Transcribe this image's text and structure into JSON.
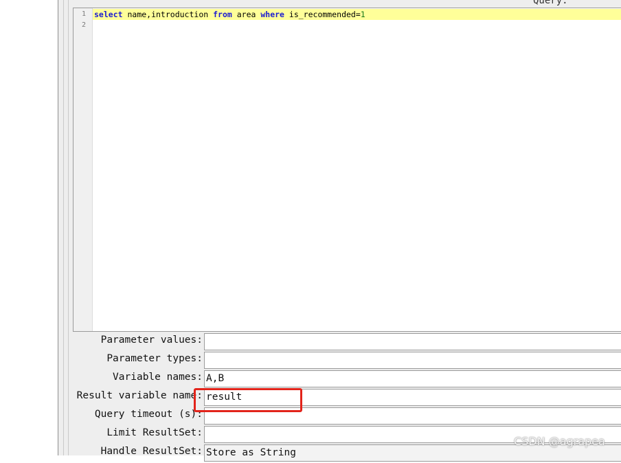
{
  "query_label": "Query:",
  "editor": {
    "line_numbers": [
      "1",
      "2"
    ],
    "lines": [
      [
        {
          "t": "select",
          "cls": "kw"
        },
        {
          "t": " name,introduction ",
          "cls": ""
        },
        {
          "t": "from",
          "cls": "kw"
        },
        {
          "t": " area ",
          "cls": ""
        },
        {
          "t": "where",
          "cls": "kw"
        },
        {
          "t": " is_recommended=",
          "cls": ""
        },
        {
          "t": "1",
          "cls": "num"
        }
      ],
      []
    ]
  },
  "form": {
    "parameter_values": {
      "label": "Parameter values:",
      "value": ""
    },
    "parameter_types": {
      "label": "Parameter types:",
      "value": ""
    },
    "variable_names": {
      "label": "Variable names:",
      "value": "A,B"
    },
    "result_variable_name": {
      "label": "Result variable name:",
      "value": "result"
    },
    "query_timeout": {
      "label": "Query timeout (s):",
      "value": ""
    },
    "limit_resultset": {
      "label": "Limit ResultSet:",
      "value": ""
    },
    "handle_resultset": {
      "label": "Handle ResultSet:",
      "value": "Store as String"
    }
  },
  "colors": {
    "highlight_box": "#e2231a",
    "current_line": "#ffff99",
    "keyword": "#1c1cd0"
  },
  "watermark": "CSDN @agrapea"
}
